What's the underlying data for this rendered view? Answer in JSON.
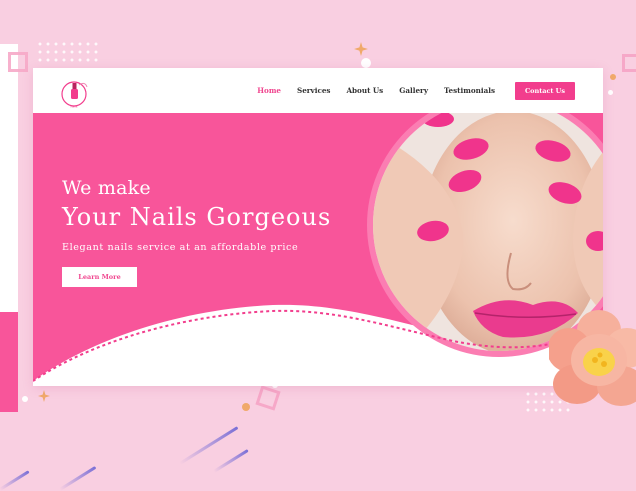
{
  "colors": {
    "background": "#f9cfe1",
    "accent": "#f23d8d",
    "hero_pink": "#f8559a",
    "nav_text": "#333333",
    "active_link": "#f0468f"
  },
  "nav": {
    "logo_icon": "nail-polish-logo-icon",
    "links": [
      {
        "label": "Home",
        "active": true
      },
      {
        "label": "Services",
        "active": false
      },
      {
        "label": "About Us",
        "active": false
      },
      {
        "label": "Gallery",
        "active": false
      },
      {
        "label": "Testimonials",
        "active": false
      }
    ],
    "contact_label": "Contact Us"
  },
  "hero": {
    "line1": "We make",
    "title": "Your Nails Gorgeous",
    "subtitle": "Elegant nails service at an affordable price",
    "cta_label": "Learn More",
    "image_icon": "woman-pink-nails-photo"
  },
  "decorations": {
    "flower_icon": "peony-flower-icon",
    "star_icon": "sparkle-star-icon"
  }
}
